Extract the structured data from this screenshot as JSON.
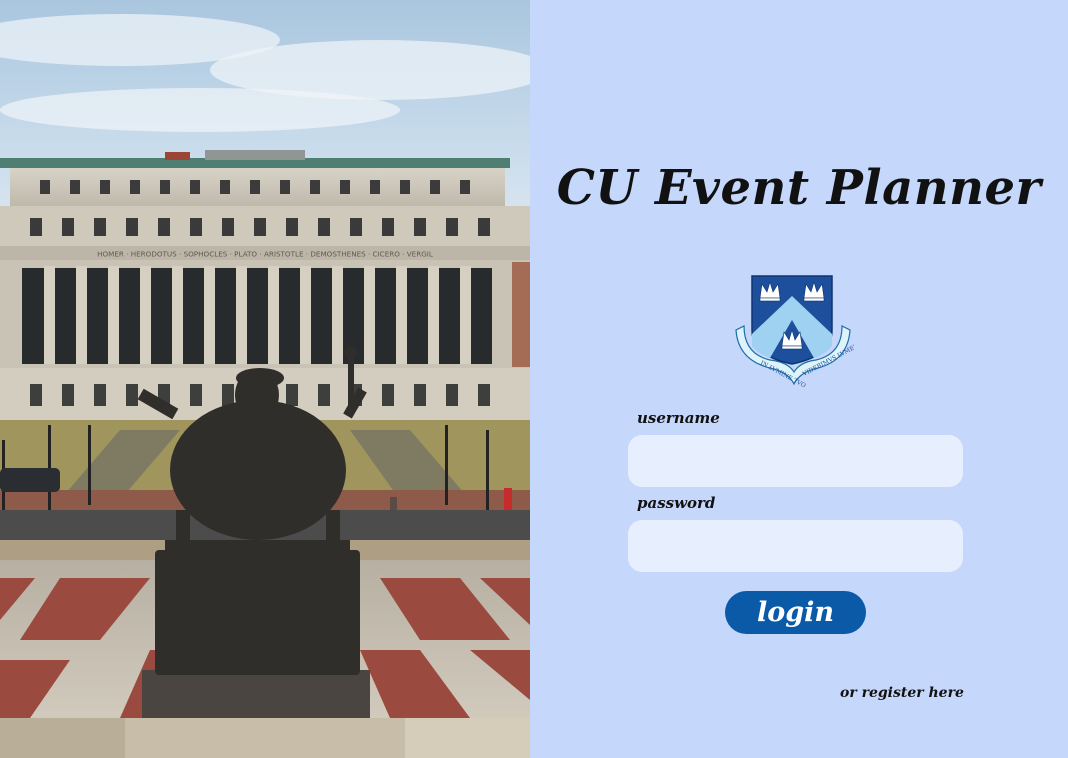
{
  "app": {
    "title": "CU Event Planner"
  },
  "photo": {
    "icon": "campus-library-photo",
    "frieze_text": "HOMER · HERODOTUS · SOPHOCLES · PLATO · ARISTOTLE · DEMOSTHENES · CICERO · VERGIL"
  },
  "crest": {
    "icon": "columbia-crest-icon",
    "motto_left": "IN LVMINE TVO",
    "motto_right": "VIDEBIMVS LVMEN"
  },
  "form": {
    "username_label": "username",
    "username_value": "",
    "password_label": "password",
    "password_value": "",
    "login_label": "login",
    "register_label": "or register here"
  },
  "colors": {
    "panel_bg": "#c6d7fc",
    "field_bg": "#e7eefe",
    "button_bg": "#0b5aa8",
    "crest_blue": "#1d4f9c",
    "crest_light": "#9fd1f0"
  }
}
